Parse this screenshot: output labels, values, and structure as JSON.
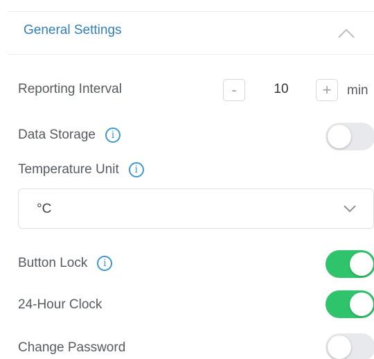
{
  "section": {
    "title": "General Settings",
    "collapse_icon": "chevron-up-icon"
  },
  "reporting_interval": {
    "label": "Reporting Interval",
    "decrement_label": "-",
    "value": "10",
    "increment_label": "+",
    "unit": "min"
  },
  "data_storage": {
    "label": "Data Storage",
    "info_glyph": "i",
    "enabled": false
  },
  "temperature_unit": {
    "label": "Temperature Unit",
    "info_glyph": "i",
    "selected": "°C",
    "chevron_icon": "chevron-down-icon"
  },
  "button_lock": {
    "label": "Button Lock",
    "info_glyph": "i",
    "enabled": true
  },
  "clock_24h": {
    "label": "24-Hour Clock",
    "enabled": true
  },
  "change_password": {
    "label": "Change Password",
    "enabled": false
  },
  "colors": {
    "accent_blue": "#2f7fb8",
    "info_blue": "#3d97d4",
    "toggle_on": "#2fc46b",
    "toggle_off": "#e7e9ec"
  }
}
